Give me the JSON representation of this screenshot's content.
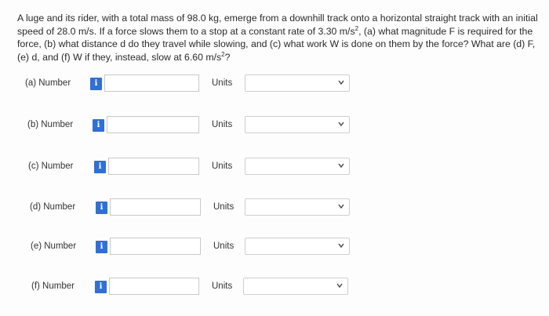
{
  "question": {
    "part1": "A luge and its rider, with a total mass of 98.0 kg, emerge from a downhill track onto a horizontal straight track with an initial speed of 28.0 m/s. If a force slows them to a stop at a constant rate of 3.30 m/s",
    "sup1": "2",
    "part2": ", (a) what magnitude F is required for the force, (b) what distance d do they travel while slowing, and (c) what work W is done on them by the force? What are (d) F, (e) d, and (f) W if they, instead, slow at 6.60 m/s",
    "sup2": "2",
    "part3": "?"
  },
  "rows": [
    {
      "label": "(a)  Number",
      "info": "i",
      "value": "",
      "units_label": "Units",
      "units_value": ""
    },
    {
      "label": "(b)  Number",
      "info": "i",
      "value": "",
      "units_label": "Units",
      "units_value": ""
    },
    {
      "label": "(c)  Number",
      "info": "i",
      "value": "",
      "units_label": "Units",
      "units_value": ""
    },
    {
      "label": "(d)  Number",
      "info": "i",
      "value": "",
      "units_label": "Units",
      "units_value": ""
    },
    {
      "label": "(e)  Number",
      "info": "i",
      "value": "",
      "units_label": "Units",
      "units_value": ""
    },
    {
      "label": "(f)  Number",
      "info": "i",
      "value": "",
      "units_label": "Units",
      "units_value": ""
    }
  ],
  "colors": {
    "info_button": "#2f6fd6",
    "border": "#c9c9c9"
  },
  "icons": {
    "info": "info-icon",
    "dropdown": "chevron-down-icon"
  }
}
